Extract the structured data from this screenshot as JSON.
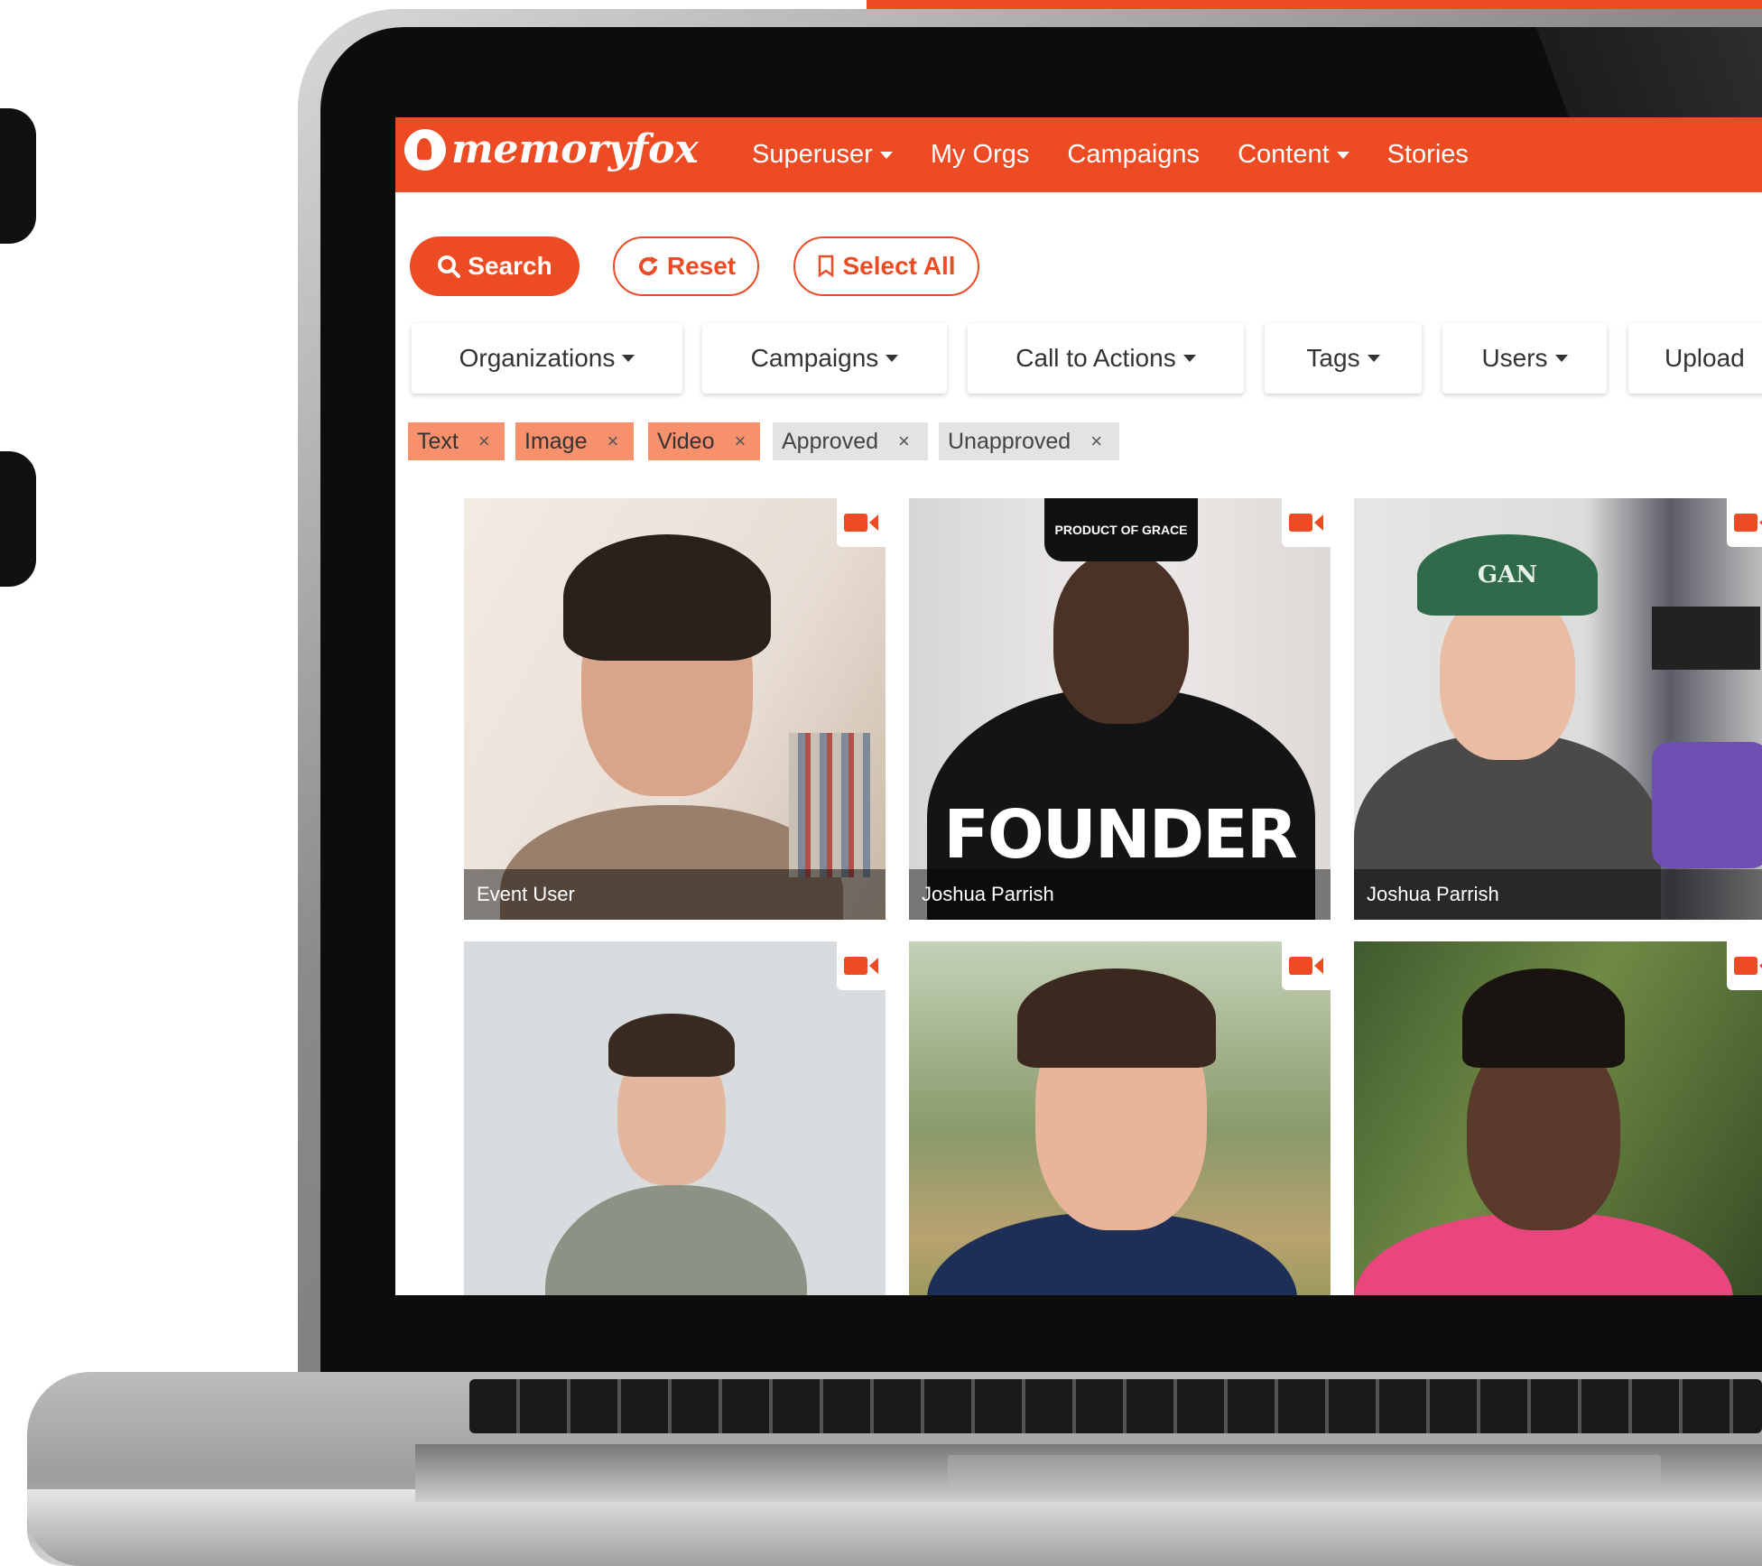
{
  "app": {
    "logo_text": "memoryfox",
    "brand_color": "#ec4b24"
  },
  "nav": {
    "items": [
      {
        "label": "Superuser",
        "dropdown": true
      },
      {
        "label": "My Orgs",
        "dropdown": false
      },
      {
        "label": "Campaigns",
        "dropdown": false
      },
      {
        "label": "Content",
        "dropdown": true
      },
      {
        "label": "Stories",
        "dropdown": false
      }
    ]
  },
  "actions": {
    "search_label": "Search",
    "reset_label": "Reset",
    "select_all_label": "Select All"
  },
  "filters": {
    "organizations": "Organizations",
    "campaigns": "Campaigns",
    "call_to_actions": "Call to Actions",
    "tags": "Tags",
    "users": "Users",
    "upload": "Upload"
  },
  "chips": [
    {
      "label": "Text",
      "active": true
    },
    {
      "label": "Image",
      "active": true
    },
    {
      "label": "Video",
      "active": true
    },
    {
      "label": "Approved",
      "active": false
    },
    {
      "label": "Unapproved",
      "active": false
    }
  ],
  "chip_remove_glyph": "×",
  "media": [
    {
      "caption": "Event User",
      "type": "video-icon"
    },
    {
      "caption": "Joshua Parrish",
      "type": "video-icon",
      "shirt_text": "FOUNDER",
      "hat_text": "PRODUCT OF GRACE"
    },
    {
      "caption": "Joshua Parrish",
      "type": "video-icon",
      "hat_text": "GAN"
    },
    {
      "caption": "",
      "type": "video-icon"
    },
    {
      "caption": "",
      "type": "video-icon"
    },
    {
      "caption": "",
      "type": "video-icon"
    }
  ]
}
